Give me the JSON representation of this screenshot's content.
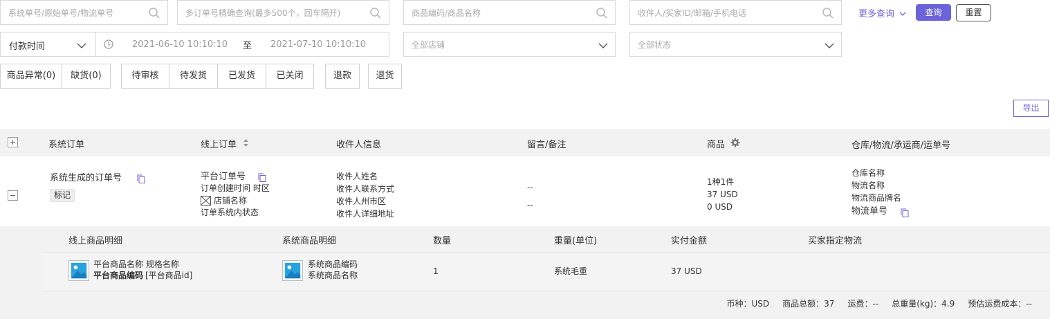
{
  "filters": {
    "search1_placeholder": "系统单号/原始单号/物流单号",
    "search2_placeholder": "多订单号精确查询(最多500个，回车隔开)",
    "search3_placeholder": "商品编码/商品名称",
    "search4_placeholder": "收件人/买家ID/邮箱/手机电话",
    "more_query": "更多查询",
    "query_button": "查询",
    "reset_button": "重置",
    "time_type": "付款时间",
    "date_start": "2021-06-10  10:10:10",
    "date_sep": "至",
    "date_end": "2021-07-10  10:10:10",
    "store_select": "全部店铺",
    "status_select": "全部状态"
  },
  "tabs": {
    "abnormal": "商品异常(0)",
    "shortage": "缺货(0)",
    "pending_review": "待审核",
    "pending_ship": "待发货",
    "shipped": "已发货",
    "closed": "已关闭",
    "refund": "退款",
    "return": "退货"
  },
  "export_button": "导出",
  "table": {
    "headers": {
      "system_order": "系统订单",
      "online_order": "线上订单",
      "recipient": "收件人信息",
      "message": "留言/备注",
      "goods": "商品",
      "logistics": "仓库/物流/承运商/运单号"
    },
    "row": {
      "system_order_no": "系统生成的订单号",
      "tag": "标记",
      "platform_order_no": "平台订单号",
      "create_time": "订单创建时间 时区",
      "store_name": "店铺名称",
      "system_status": "订单系统内状态",
      "recipient_name": "收件人姓名",
      "recipient_contact": "收件人联系方式",
      "recipient_region": "收件人州市区",
      "recipient_address": "收件人详细地址",
      "message": "--",
      "remark": "--",
      "goods_count": "1种1件",
      "goods_amount": "37 USD",
      "goods_other": "0 USD",
      "warehouse": "仓库名称",
      "logistics_name": "物流名称",
      "logistics_brand": "物流商品牌名",
      "tracking_no": "物流单号"
    }
  },
  "detail": {
    "headers": {
      "online_goods": "线上商品明细",
      "system_goods": "系统商品明细",
      "quantity": "数量",
      "weight": "重量(单位)",
      "paid": "实付金额",
      "buyer_logistics": "买家指定物流"
    },
    "item": {
      "platform_goods_name": "平台商品名称  规格名称",
      "platform_goods_code": "平台商品编码",
      "platform_goods_id": "[平台商品id]",
      "system_goods_code": "系统商品编码",
      "system_goods_name": "系统商品名称",
      "quantity": "1",
      "weight": "系统毛重",
      "paid": "37 USD"
    },
    "summary": "币种：USD     商品总额：37     运费：--     总重量(kg)：4.9     预估运费成本：--"
  },
  "colors": {
    "accent": "#6b63d9",
    "header_bg": "#f2f2f2"
  }
}
